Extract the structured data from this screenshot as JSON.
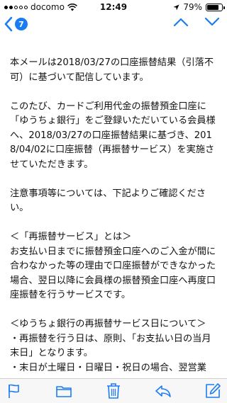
{
  "status_bar": {
    "carrier": "docomo",
    "time": "12:49",
    "battery_percent": "79%",
    "battery_level": 0.79
  },
  "nav": {
    "back_count": "7"
  },
  "email": {
    "body": "ございます。\n\n本メールは2018/03/27の口座振替結果（引落不可）に基づいて配信しています。\n\nこのたび、カードご利用代金の振替預金口座に「ゆうちょ銀行」をご登録いただいている会員様へ、2018/03/27の口座振替結果に基づき、2018/04/02に口座振替（再振替サービス）を実施させていただきます。\n\n注意事項等については、下記よりご確認ください。\n\n＜「再振替サービス」とは＞\nお支払い日までに振替預金口座へのご入金が間に合わなかった等の理由で口座振替ができなかった場合、翌日以降に会員様の振替預金口座へ再度口座振替を行うサービスです。\n\n＜ゆうちょ銀行の再振替サービス日について＞\n・再振替を行う日は、原則、「お支払い日の当月末日」となります。\n・末日が土曜日・日曜日・祝日の場合、翌営業"
  },
  "icons": {
    "flag": "flag-icon",
    "folder": "folder-icon",
    "trash": "trash-icon",
    "reply": "reply-icon",
    "compose": "compose-icon"
  },
  "colors": {
    "accent": "#1a7cf5"
  }
}
